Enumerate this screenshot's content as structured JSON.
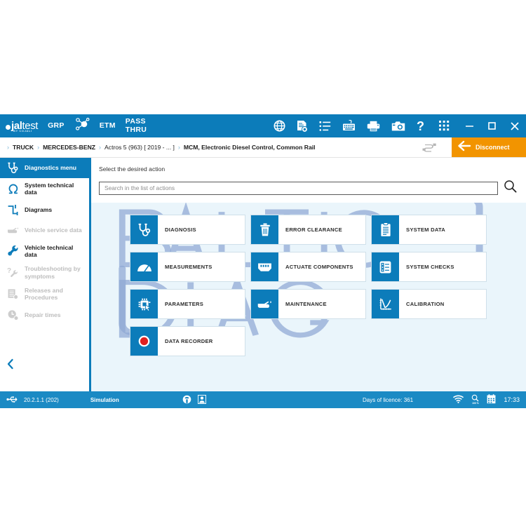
{
  "brand": {
    "logo_text_1": "jal",
    "logo_text_2": "test",
    "logo_sub": "BY COJALI",
    "watermark": "BALTIC DIAG",
    "accent_blue": "#0c7cba",
    "status_blue": "#1b8ac4",
    "orange": "#f29400",
    "panel_bg": "#eaf5fb"
  },
  "titlebar": {
    "grp_label": "GRP",
    "grp_icon": "molecule-icon",
    "etm_label": "ETM",
    "passthru_label": "PASS\nTHRU",
    "icons": [
      {
        "name": "globe-icon",
        "title": "Globe"
      },
      {
        "name": "document-view-icon",
        "title": "Document"
      },
      {
        "name": "list-icon",
        "title": "List"
      },
      {
        "name": "keyboard-icon",
        "title": "Keyboard"
      },
      {
        "name": "printer-icon",
        "title": "Printer"
      },
      {
        "name": "camera-icon",
        "title": "Camera"
      },
      {
        "name": "help-icon",
        "title": "Help",
        "glyph": "?"
      }
    ],
    "apps_grid_icon": "apps-grid-icon",
    "window_controls": {
      "minimize": "minimize-icon",
      "maximize": "maximize-icon",
      "close": "close-icon"
    }
  },
  "breadcrumb": {
    "separator": "›",
    "items": [
      {
        "label": "TRUCK",
        "bold": true
      },
      {
        "label": "MERCEDES-BENZ",
        "bold": true
      },
      {
        "label": "Actros 5 (963) [ 2019 - ... ]",
        "bold": false
      },
      {
        "label": "MCM, Electronic Diesel Control, Common Rail",
        "bold": true
      }
    ],
    "plug_icon": "cable-plug-icon",
    "disconnect_label": "Disconnect",
    "disconnect_icon": "arrow-left-icon"
  },
  "sidebar": {
    "items": [
      {
        "label": "Diagnostics menu",
        "icon": "stethoscope-icon",
        "active": true,
        "disabled": false
      },
      {
        "label": "System technical data",
        "icon": "omega-icon",
        "active": false,
        "disabled": false
      },
      {
        "label": "Diagrams",
        "icon": "diagram-icon",
        "active": false,
        "disabled": false
      },
      {
        "label": "Vehicle service data",
        "icon": "oil-can-icon",
        "active": false,
        "disabled": true
      },
      {
        "label": "Vehicle technical data",
        "icon": "wrench-icon",
        "active": false,
        "disabled": false
      },
      {
        "label": "Troubleshooting by symptoms",
        "icon": "question-wrench-icon",
        "active": false,
        "disabled": true
      },
      {
        "label": "Releases and Procedures",
        "icon": "documents-icon",
        "active": false,
        "disabled": true
      },
      {
        "label": "Repair times",
        "icon": "clock-gear-icon",
        "active": false,
        "disabled": true
      }
    ],
    "collapse_icon": "chevron-left-icon"
  },
  "main": {
    "heading": "Select the desired action",
    "search": {
      "placeholder": "Search in the list of actions",
      "value": "",
      "icon": "search-icon"
    },
    "actions": [
      {
        "label": "DIAGNOSIS",
        "icon": "stethoscope-icon"
      },
      {
        "label": "ERROR CLEARANCE",
        "icon": "trash-icon"
      },
      {
        "label": "SYSTEM DATA",
        "icon": "clipboard-icon"
      },
      {
        "label": "MEASUREMENTS",
        "icon": "gauge-icon"
      },
      {
        "label": "ACTUATE COMPONENTS",
        "icon": "connector-icon"
      },
      {
        "label": "SYSTEM CHECKS",
        "icon": "checklist-icon"
      },
      {
        "label": "PARAMETERS",
        "icon": "chip-cursor-icon"
      },
      {
        "label": "MAINTENANCE",
        "icon": "oil-can-icon"
      },
      {
        "label": "CALIBRATION",
        "icon": "curve-chart-icon"
      },
      {
        "label": "DATA RECORDER",
        "icon": "record-icon"
      }
    ]
  },
  "statusbar": {
    "usb_icon": "usb-icon",
    "version": "20.2.1.1 (202)",
    "mode": "Simulation",
    "mid_icons": [
      {
        "name": "support-icon"
      },
      {
        "name": "user-icon"
      }
    ],
    "licence": "Days of licence: 361",
    "wifi_icon": "wifi-icon",
    "zoom_icon": "zoom-level-icon",
    "zoom_level": "100 %",
    "calendar_icon": "calendar-icon",
    "time": "17:33"
  }
}
